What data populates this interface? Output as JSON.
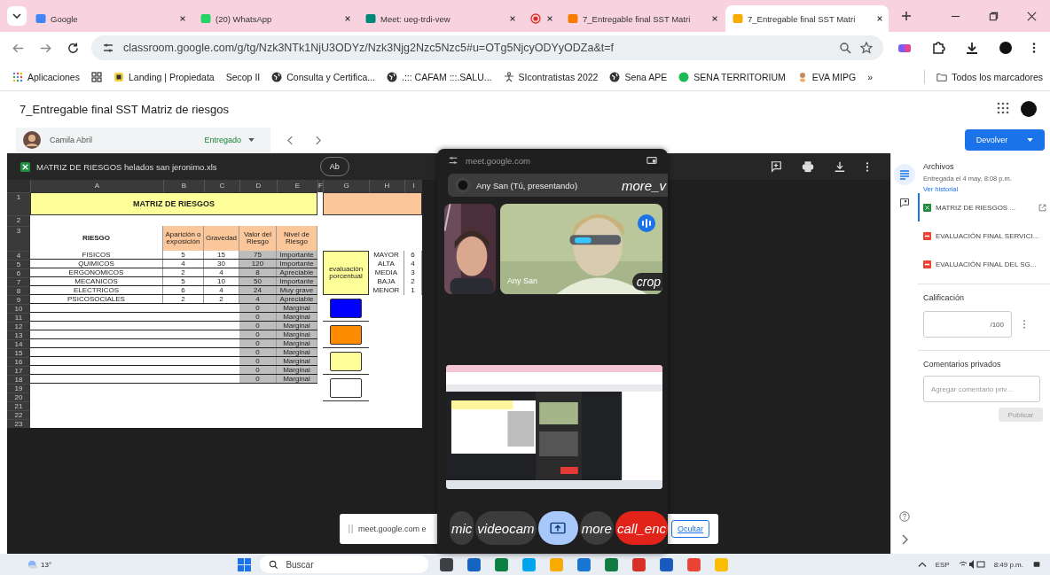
{
  "browser": {
    "tabs": [
      {
        "title": "Google",
        "kind": "google",
        "selected": false
      },
      {
        "title": "(20) WhatsApp",
        "kind": "whatsapp",
        "selected": false
      },
      {
        "title": "Meet: ueg-trdi-vew",
        "kind": "meet",
        "selected": false
      },
      {
        "kind": "record",
        "selected": false
      },
      {
        "title": "7_Entregable final SST Matri",
        "kind": "classroom-orange",
        "selected": false
      },
      {
        "title": "7_Entregable final SST Matri",
        "kind": "classroom-yellow",
        "selected": true
      }
    ],
    "url": "classroom.google.com/g/tg/Nzk3NTk1NjU3ODYz/Nzk3Njg2Nzc5Nzc5#u=OTg5NjcyODYyODZa&t=f",
    "bookmarks": [
      {
        "label": "Aplicaciones",
        "kind": "apps"
      },
      {
        "kind": "grid"
      },
      {
        "label": "Landing | Propiedata",
        "kind": "square"
      },
      {
        "label": "Secop II",
        "kind": "plain"
      },
      {
        "label": "Consulta y Certifica...",
        "kind": "globe"
      },
      {
        "label": ".::: CAFAM :::.SALU...",
        "kind": "globe"
      },
      {
        "label": "SIcontratistas 2022",
        "kind": "figure"
      },
      {
        "label": "Sena APE",
        "kind": "globe"
      },
      {
        "label": "SENA TERRITORIUM",
        "kind": "dot"
      },
      {
        "label": "EVA MIPG",
        "kind": "person"
      },
      {
        "label": "»",
        "kind": "plain"
      }
    ],
    "all_bookmarks": "Todos los marcadores"
  },
  "page": {
    "title": "7_Entregable final SST Matriz de riesgos",
    "student": "Camila Abril",
    "status": "Entregado",
    "return_button": "Devolver"
  },
  "viewer": {
    "file_name": "MATRIZ DE RIESGOS helados san jeronimo.xls",
    "open_button": "Ab",
    "sheet": {
      "columns": [
        "A",
        "B",
        "C",
        "D",
        "E",
        "F",
        "G",
        "H",
        "I"
      ],
      "row_numbers": [
        "1",
        "2",
        "3",
        "4",
        "5",
        "6",
        "7",
        "8",
        "9",
        "10",
        "11",
        "12",
        "13",
        "14",
        "15",
        "16",
        "17",
        "18",
        "19",
        "20",
        "21",
        "22",
        "23"
      ],
      "title": "MATRIZ DE RIESGOS",
      "headers": [
        "RIESGO",
        "Aparición o exposición",
        "Gravedad",
        "Valor del Riesgo",
        "Nivel de Riesgo"
      ],
      "rows": [
        {
          "risk": "FISICOS",
          "appearance": "5",
          "severity": "15",
          "value": "75",
          "level": "Importante"
        },
        {
          "risk": "QUIMICOS",
          "appearance": "4",
          "severity": "30",
          "value": "120",
          "level": "Importante"
        },
        {
          "risk": "ERGONOMICOS",
          "appearance": "2",
          "severity": "4",
          "value": "8",
          "level": "Apreciable"
        },
        {
          "risk": "MECANICOS",
          "appearance": "5",
          "severity": "10",
          "value": "50",
          "level": "Importante"
        },
        {
          "risk": "ELECTRICOS",
          "appearance": "6",
          "severity": "4",
          "value": "24",
          "level": "Muy grave"
        },
        {
          "risk": "PSICOSOCIALES",
          "appearance": "2",
          "severity": "2",
          "value": "4",
          "level": "Apreciable"
        },
        {
          "value": "0",
          "level": "Marginal"
        },
        {
          "value": "0",
          "level": "Marginal"
        },
        {
          "value": "0",
          "level": "Marginal"
        },
        {
          "value": "0",
          "level": "Marginal"
        },
        {
          "value": "0",
          "level": "Marginal"
        },
        {
          "value": "0",
          "level": "Marginal"
        },
        {
          "value": "0",
          "level": "Marginal"
        },
        {
          "value": "0",
          "level": "Marginal"
        },
        {
          "value": "0",
          "level": "Marginal"
        }
      ],
      "legend": {
        "label": "evaluación porcentual",
        "levels": [
          {
            "label": "MAYOR",
            "value": "6"
          },
          {
            "label": "ALTA",
            "value": "4"
          },
          {
            "label": "MEDIA",
            "value": "3"
          },
          {
            "label": "BAJA",
            "value": "2"
          },
          {
            "label": "MENOR",
            "value": "1"
          }
        ]
      },
      "swatches": [
        {
          "color": "#0000ff"
        },
        {
          "color": "#ff8c00"
        },
        {
          "color": "#ffff99"
        },
        {
          "color": "#ffffff"
        }
      ]
    }
  },
  "meet": {
    "address": "meet.google.com",
    "presenter": "Any San (Tú, presentando)",
    "presenter_menu": "more_v",
    "tiles": [
      {
        "kind": "self"
      },
      {
        "kind": "speaker",
        "name": "Any San",
        "speaking": true,
        "corner": "crop"
      }
    ],
    "controls": [
      {
        "label": "mic",
        "kind": "round"
      },
      {
        "label": "videocam",
        "kind": "round"
      },
      {
        "kind": "active"
      },
      {
        "label": "more",
        "kind": "round"
      },
      {
        "label": "call_enc",
        "kind": "end"
      }
    ],
    "notice": {
      "text": "meet.google.com e",
      "hide": "Ocultar"
    }
  },
  "side": {
    "files_title": "Archivos",
    "submitted": "Entregada el 4 may, 8:08 p.m.",
    "history": "Ver historial",
    "files": [
      {
        "name": "MATRIZ DE RIESGOS ...",
        "kind": "sheet",
        "selected": true
      },
      {
        "name": "EVALUACIÓN FINAL SERVICI...",
        "kind": "pdf",
        "selected": false
      },
      {
        "name": "EVALUACIÓN FINAL DEL SG...",
        "kind": "pdf",
        "selected": false
      }
    ],
    "grade_title": "Calificación",
    "grade_suffix": "/100",
    "comments_title": "Comentarios privados",
    "comment_placeholder": "Agregar comentario priv...",
    "publish": "Publicar",
    "publish_disabled": true
  },
  "taskbar": {
    "weather": "13°",
    "search": "Buscar",
    "language": "ESP",
    "time": "8:49 p.m."
  }
}
